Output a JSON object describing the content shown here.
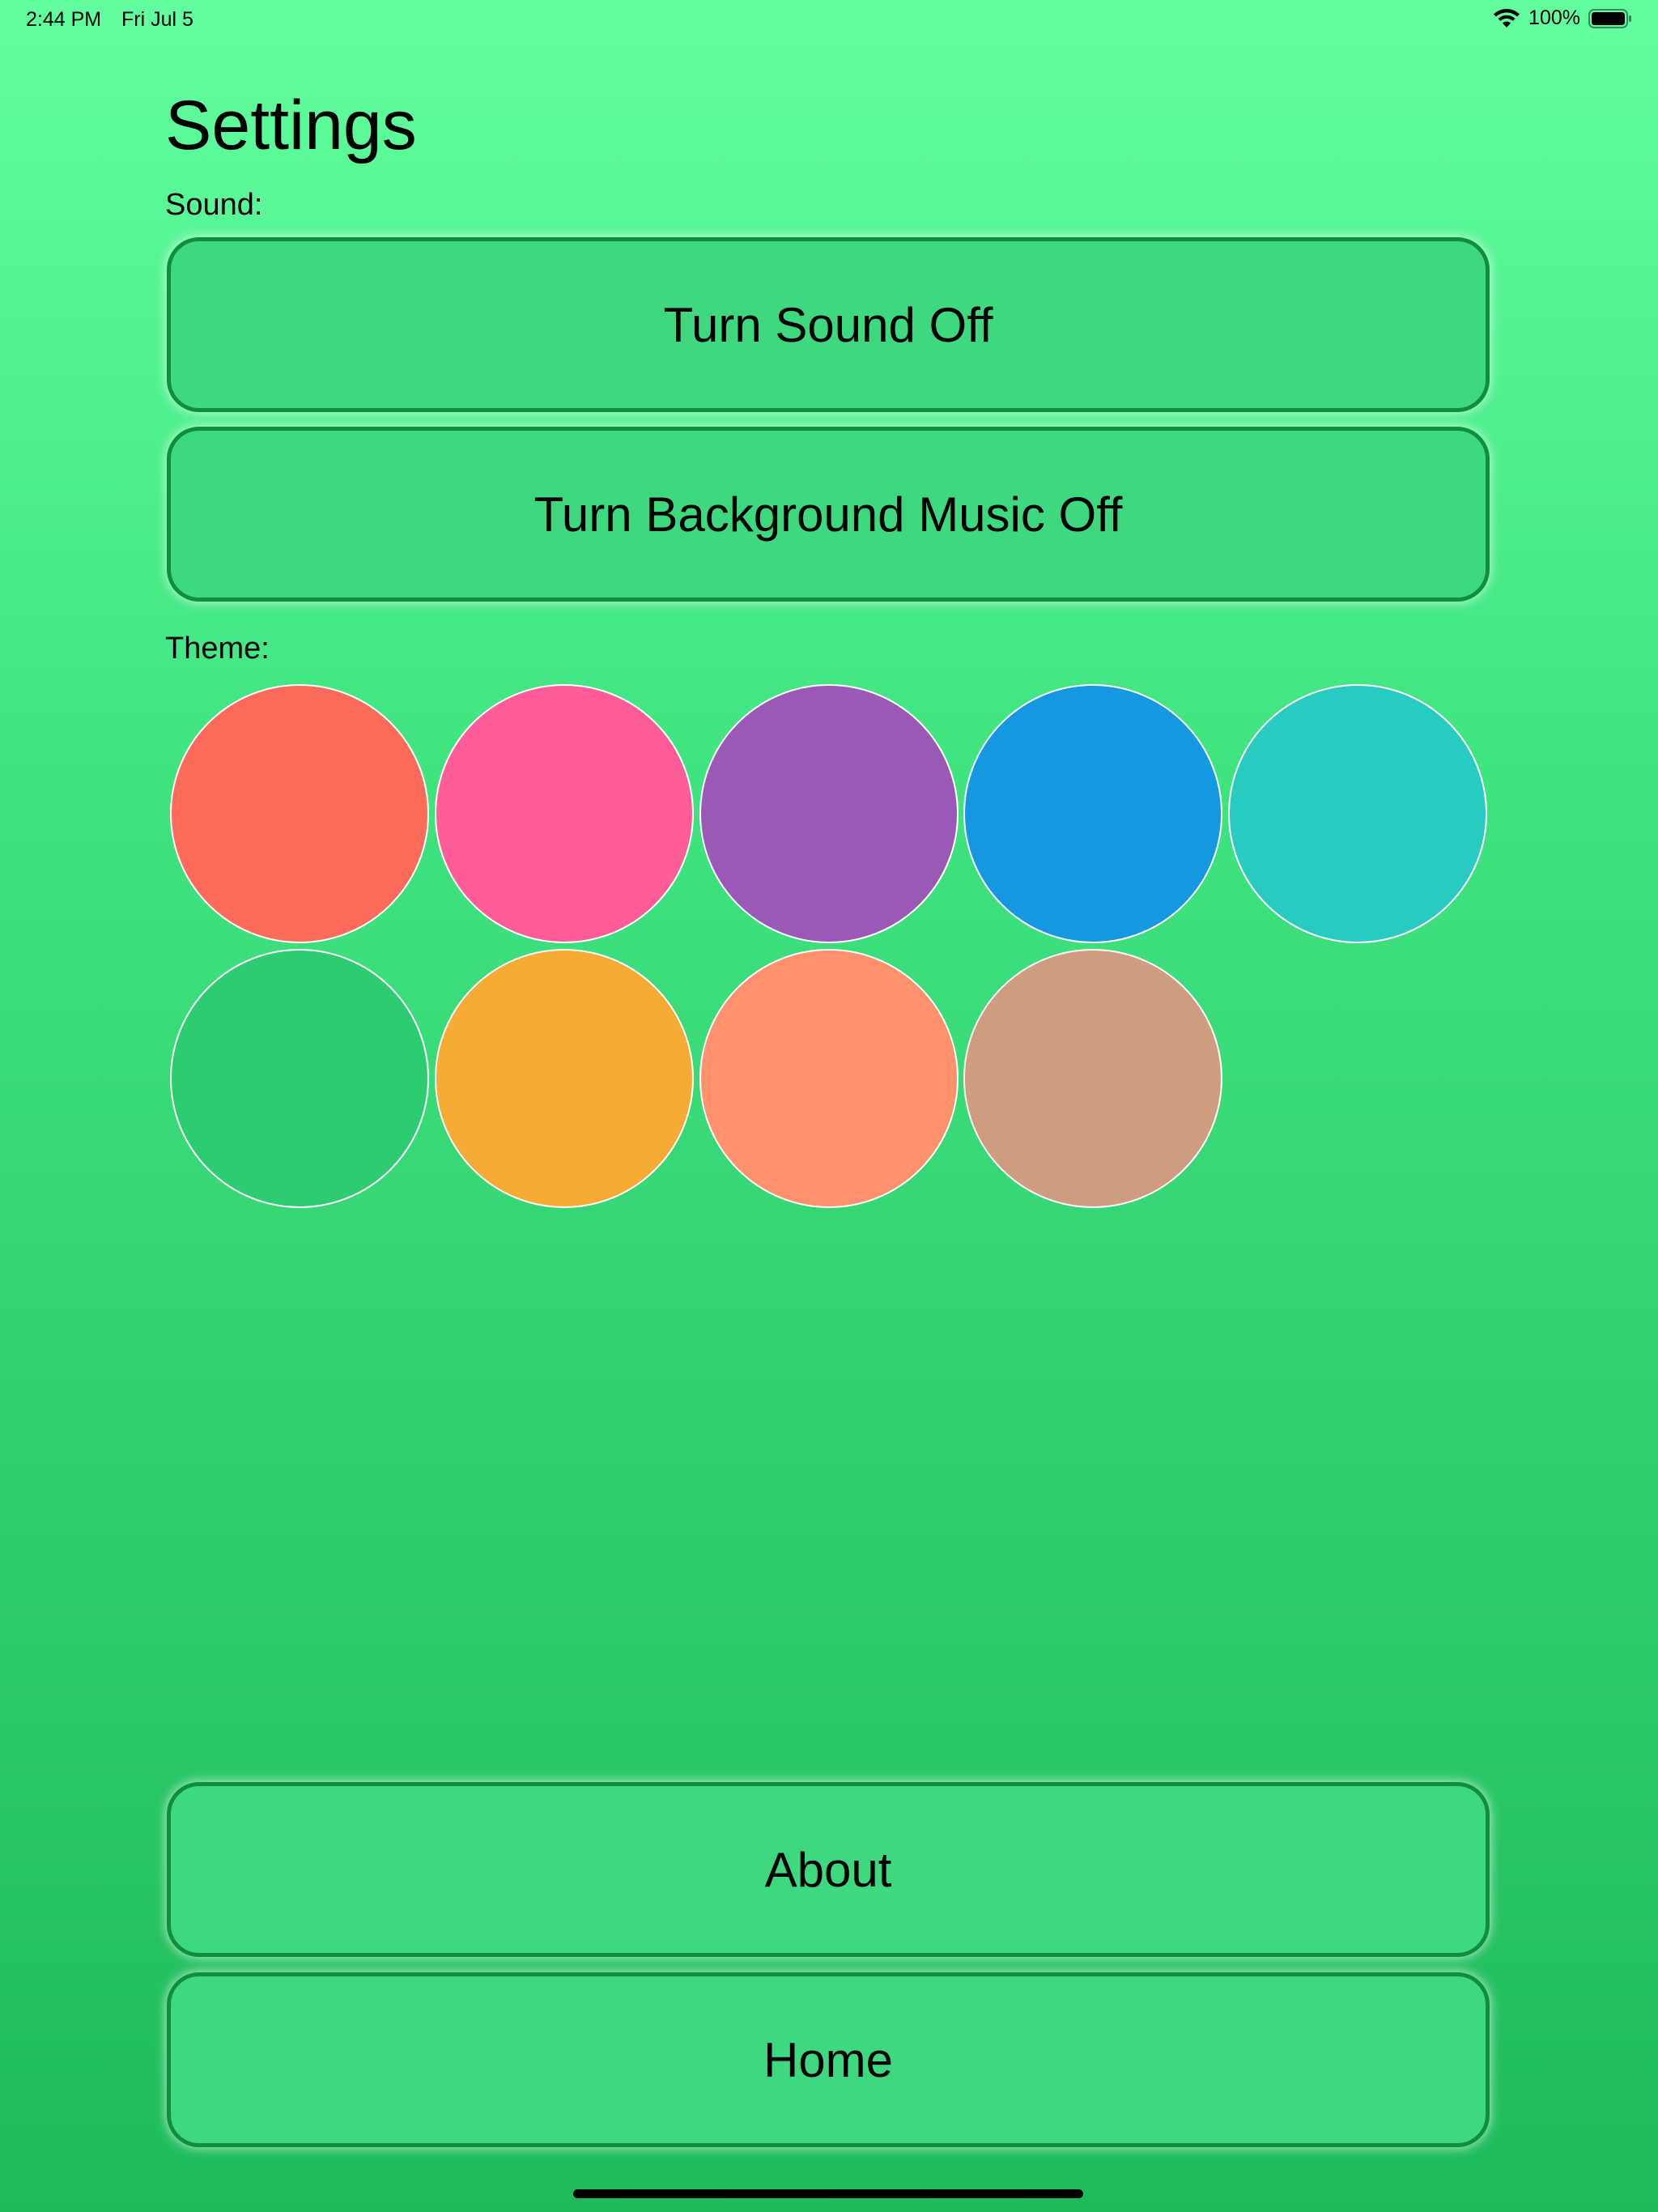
{
  "status_bar": {
    "time": "2:44 PM",
    "date": "Fri Jul 5",
    "battery_percent": "100%",
    "wifi_icon": "wifi-icon",
    "battery_icon": "battery-icon"
  },
  "page": {
    "title": "Settings"
  },
  "sound": {
    "label": "Sound:",
    "sound_button_label": "Turn Sound Off",
    "music_button_label": "Turn Background Music Off"
  },
  "theme": {
    "label": "Theme:",
    "swatches": [
      {
        "color": "#ff6b5b"
      },
      {
        "color": "#fe5d98"
      },
      {
        "color": "#9b59b6"
      },
      {
        "color": "#1598e0"
      },
      {
        "color": "#28cbbf"
      },
      {
        "color": "#2ecc71"
      },
      {
        "color": "#f6ab35"
      },
      {
        "color": "#ff916d"
      },
      {
        "color": "#ce9c7e"
      }
    ]
  },
  "navigation": {
    "about_label": "About",
    "home_label": "Home"
  },
  "colors": {
    "button_fill": "#3ed97f",
    "button_border": "#0f8f3e",
    "background_top": "#63fe9e",
    "background_bottom": "#1fbb5a"
  }
}
